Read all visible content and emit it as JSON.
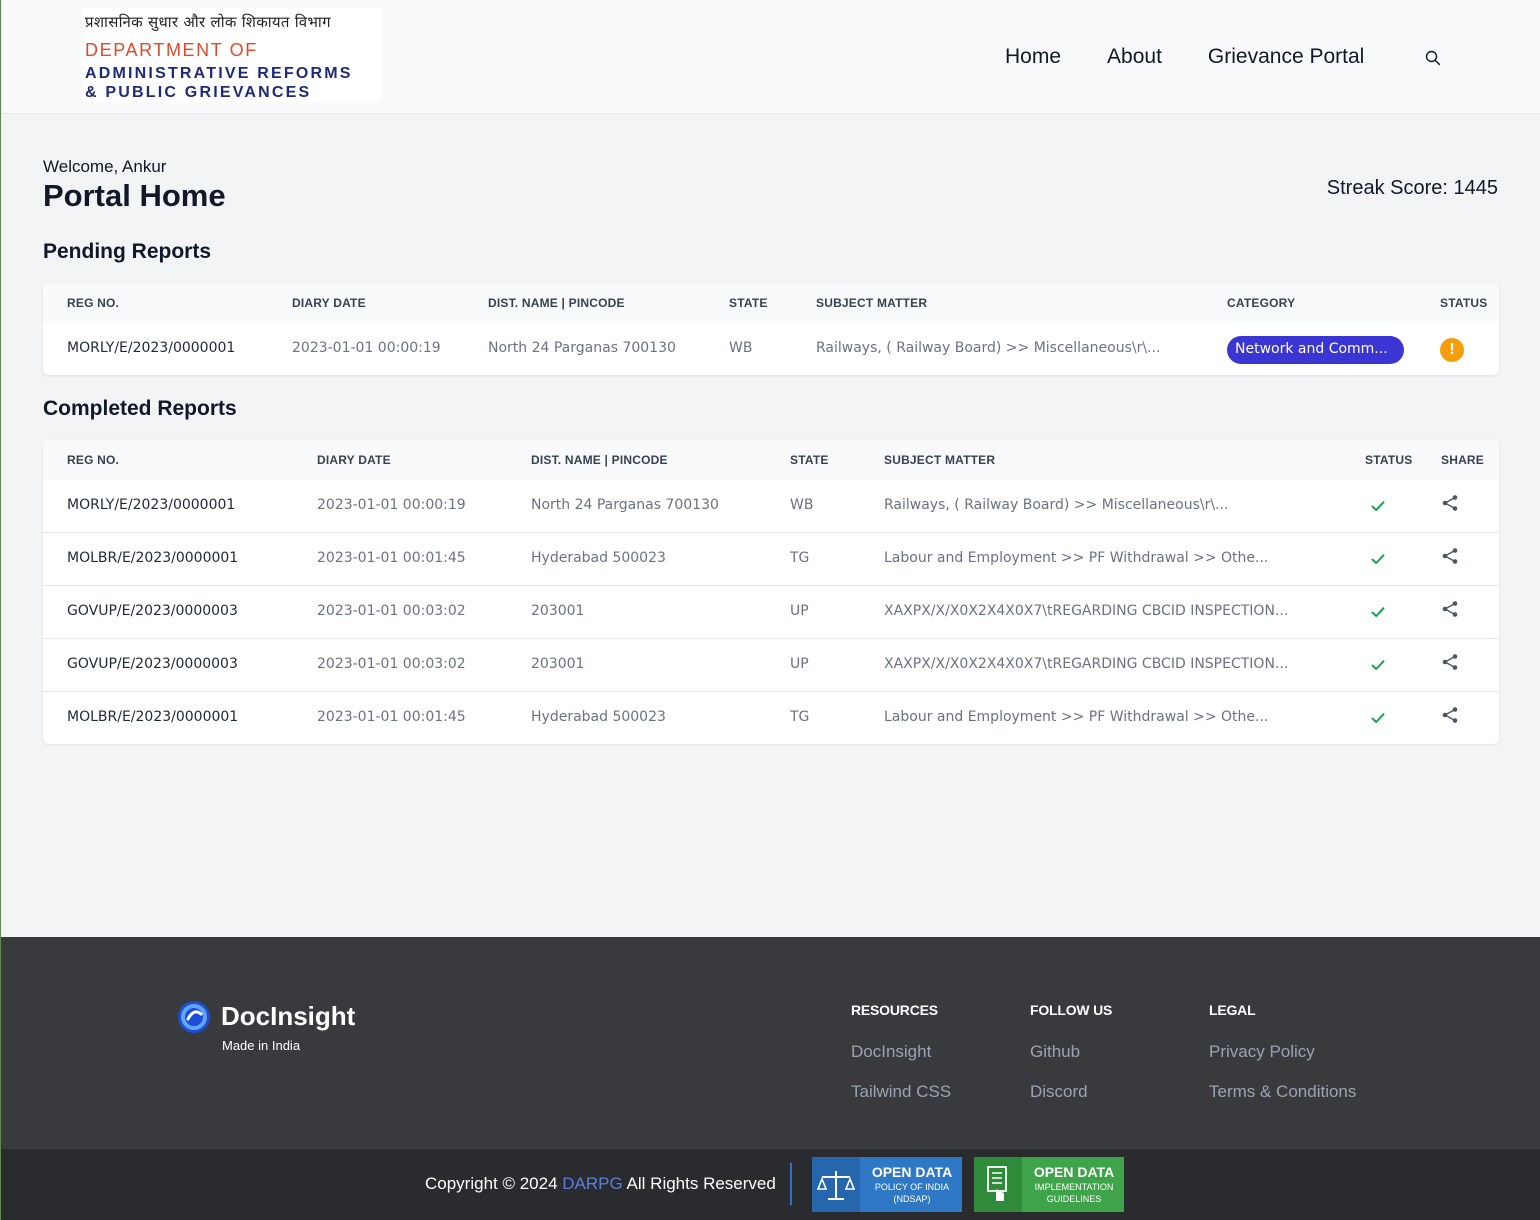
{
  "header": {
    "logo": {
      "hindi": "प्रशासनिक सुधार और लोक शिकायत विभाग",
      "line1": "DEPARTMENT OF",
      "line2": "ADMINISTRATIVE REFORMS",
      "line3": "& PUBLIC GRIEVANCES"
    },
    "nav": [
      "Home",
      "About",
      "Grievance Portal"
    ],
    "search_icon": "search-icon"
  },
  "main": {
    "welcome": "Welcome, Ankur",
    "title": "Portal Home",
    "streak": "Streak Score: 1445",
    "pending": {
      "title": "Pending Reports",
      "columns": [
        "REG NO.",
        "DIARY DATE",
        "DIST. NAME | PINCODE",
        "STATE",
        "SUBJECT MATTER",
        "CATEGORY",
        "STATUS"
      ],
      "rows": [
        {
          "reg": "MORLY/E/2023/0000001",
          "date": "2023-01-01 00:00:19",
          "dist": "North 24 Parganas 700130",
          "state": "WB",
          "subject": "Railways, ( Railway Board) >> Miscellaneous\\r\\...",
          "category": "Network and Comm...",
          "status_icon": "warning-icon"
        }
      ]
    },
    "completed": {
      "title": "Completed Reports",
      "columns": [
        "REG NO.",
        "DIARY DATE",
        "DIST. NAME | PINCODE",
        "STATE",
        "SUBJECT MATTER",
        "STATUS",
        "SHARE"
      ],
      "rows": [
        {
          "reg": "MORLY/E/2023/0000001",
          "date": "2023-01-01 00:00:19",
          "dist": "North 24 Parganas 700130",
          "state": "WB",
          "subject": "Railways, ( Railway Board) >> Miscellaneous\\r\\..."
        },
        {
          "reg": "MOLBR/E/2023/0000001",
          "date": "2023-01-01 00:01:45",
          "dist": "Hyderabad 500023",
          "state": "TG",
          "subject": "Labour and Employment >> PF Withdrawal >> Othe..."
        },
        {
          "reg": "GOVUP/E/2023/0000003",
          "date": "2023-01-01 00:03:02",
          "dist": "203001",
          "state": "UP",
          "subject": "XAXPX/X/X0X2X4X0X7\\tREGARDING CBCID INSPECTION..."
        },
        {
          "reg": "GOVUP/E/2023/0000003",
          "date": "2023-01-01 00:03:02",
          "dist": "203001",
          "state": "UP",
          "subject": "XAXPX/X/X0X2X4X0X7\\tREGARDING CBCID INSPECTION..."
        },
        {
          "reg": "MOLBR/E/2023/0000001",
          "date": "2023-01-01 00:01:45",
          "dist": "Hyderabad 500023",
          "state": "TG",
          "subject": "Labour and Employment >> PF Withdrawal >> Othe..."
        }
      ]
    }
  },
  "footer": {
    "brand": "DocInsight",
    "tagline": "Made in India",
    "columns": [
      {
        "title": "RESOURCES",
        "links": [
          "DocInsight",
          "Tailwind CSS"
        ]
      },
      {
        "title": "FOLLOW US",
        "links": [
          "Github",
          "Discord"
        ]
      },
      {
        "title": "LEGAL",
        "links": [
          "Privacy Policy",
          "Terms & Conditions"
        ]
      }
    ],
    "copyright_pre": "Copyright © 2024",
    "copyright_org": "DARPG",
    "copyright_post": "All Rights Reserved",
    "badges": [
      {
        "title": "OPEN DATA",
        "sub1": "POLICY OF INDIA",
        "sub2": "(NDSAP)",
        "icon": "scales-icon"
      },
      {
        "title": "OPEN DATA",
        "sub1": "IMPLEMENTATION",
        "sub2": "GUIDELINES",
        "icon": "document-hand-icon"
      }
    ]
  },
  "colors": {
    "accent": "#3b35d3",
    "warning": "#f59e0b",
    "success": "#16a34a",
    "footer_bg": "#393a3e",
    "link_blue": "#5b7fe0"
  }
}
